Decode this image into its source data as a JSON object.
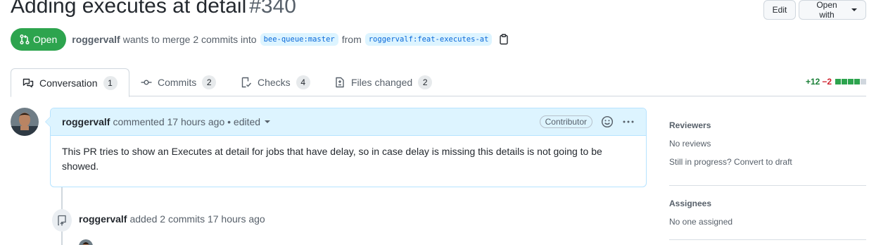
{
  "pr": {
    "title": "Adding executes at detail",
    "number": "#340",
    "state": "Open",
    "author": "roggervalf",
    "merge_text": "wants to merge 2 commits into",
    "base_branch": "bee-queue:master",
    "from_text": "from",
    "head_branch": "roggervalf:feat-executes-at"
  },
  "header_buttons": {
    "edit": "Edit",
    "open_with": "Open with"
  },
  "tabs": [
    {
      "label": "Conversation",
      "count": "1",
      "icon": "comment-discussion-icon"
    },
    {
      "label": "Commits",
      "count": "2",
      "icon": "git-commit-icon"
    },
    {
      "label": "Checks",
      "count": "4",
      "icon": "checklist-icon"
    },
    {
      "label": "Files changed",
      "count": "2",
      "icon": "file-diff-icon"
    }
  ],
  "diffstat": {
    "additions": "+12",
    "deletions": "−2",
    "blocks": [
      "green",
      "green",
      "green",
      "green",
      "gray"
    ]
  },
  "comment": {
    "author": "roggervalf",
    "action": "commented",
    "time": "17 hours ago",
    "edited": "• edited",
    "role": "Contributor",
    "body": "This PR tries to show an Executes at detail for jobs that have delay, so in case delay is missing this details is not going to be showed."
  },
  "event": {
    "author": "roggervalf",
    "text": "added 2 commits 17 hours ago"
  },
  "sidebar": {
    "reviewers_heading": "Reviewers",
    "reviewers_value": "No reviews",
    "draft_text": "Still in progress? Convert to draft",
    "assignees_heading": "Assignees",
    "assignees_value": "No one assigned"
  },
  "colors": {
    "open_green": "#2da44e",
    "link_blue": "#0969da",
    "add_green": "#1a7f37",
    "del_red": "#cf222e"
  }
}
